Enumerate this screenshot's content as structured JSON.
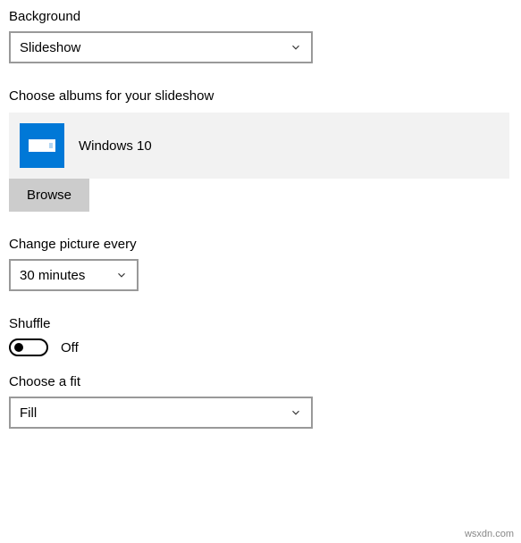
{
  "background": {
    "label": "Background",
    "value": "Slideshow"
  },
  "albums": {
    "label": "Choose albums for your slideshow",
    "selected": "Windows 10",
    "browse_label": "Browse"
  },
  "interval": {
    "label": "Change picture every",
    "value": "30 minutes"
  },
  "shuffle": {
    "label": "Shuffle",
    "state_label": "Off",
    "on": false
  },
  "fit": {
    "label": "Choose a fit",
    "value": "Fill"
  },
  "watermark": "wsxdn.com"
}
